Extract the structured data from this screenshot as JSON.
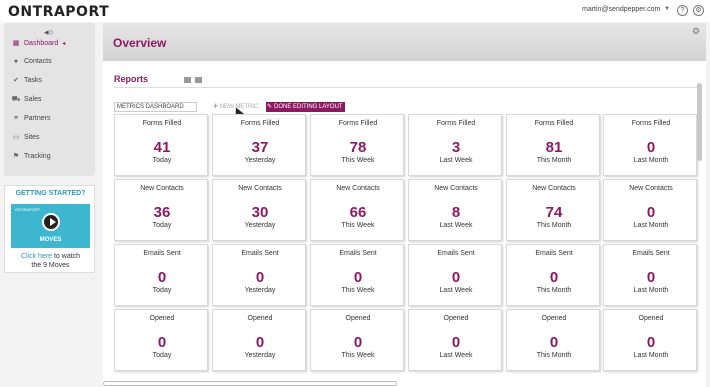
{
  "app": {
    "logo": "ONTRAPORT",
    "user_email": "martin@sendpepper.com",
    "user_caret": "▼",
    "help": "?",
    "gear": "⚙"
  },
  "sidebar": {
    "collapse": "◂○",
    "items": [
      {
        "label": "Dashboard",
        "icon": "▦"
      },
      {
        "label": "Contacts",
        "icon": "●"
      },
      {
        "label": "Tasks",
        "icon": "✔"
      },
      {
        "label": "Sales",
        "icon": "⛟"
      },
      {
        "label": "Partners",
        "icon": "⚭"
      },
      {
        "label": "Sites",
        "icon": "▭"
      },
      {
        "label": "Tracking",
        "icon": "⚑"
      }
    ],
    "active_caret": "◂"
  },
  "promo": {
    "title": "GETTING STARTED?",
    "image_brand": "ONTRAPORT",
    "image_caption": "MOVES",
    "link": "Click here",
    "text_after": " to watch",
    "text_line2": "the 9 Moves"
  },
  "main": {
    "title": "Overview",
    "gear": "⚙",
    "reports_title": "Reports",
    "dashboard_select": "METRICS DASHBOARD",
    "new_metric": "✚ NEW METRIC",
    "done_label": "DONE EDITING LAYOUT",
    "done_icon": "✎"
  },
  "metrics": [
    [
      {
        "label": "Forms Filled",
        "value": "41",
        "period": "Today"
      },
      {
        "label": "Forms Filled",
        "value": "37",
        "period": "Yesterday"
      },
      {
        "label": "Forms Filled",
        "value": "78",
        "period": "This Week"
      },
      {
        "label": "Forms Filled",
        "value": "3",
        "period": "Last Week"
      },
      {
        "label": "Forms Filled",
        "value": "81",
        "period": "This Month"
      },
      {
        "label": "Forms Filled",
        "value": "0",
        "period": "Last Month"
      }
    ],
    [
      {
        "label": "New Contacts",
        "value": "36",
        "period": "Today"
      },
      {
        "label": "New Contacts",
        "value": "30",
        "period": "Yesterday"
      },
      {
        "label": "New Contacts",
        "value": "66",
        "period": "This Week"
      },
      {
        "label": "New Contacts",
        "value": "8",
        "period": "Last Week"
      },
      {
        "label": "New Contacts",
        "value": "74",
        "period": "This Month"
      },
      {
        "label": "New Contacts",
        "value": "0",
        "period": "Last Month"
      }
    ],
    [
      {
        "label": "Emails Sent",
        "value": "0",
        "period": "Today"
      },
      {
        "label": "Emails Sent",
        "value": "0",
        "period": "Yesterday"
      },
      {
        "label": "Emails Sent",
        "value": "0",
        "period": "This Week"
      },
      {
        "label": "Emails Sent",
        "value": "0",
        "period": "Last Week"
      },
      {
        "label": "Emails Sent",
        "value": "0",
        "period": "This Month"
      },
      {
        "label": "Emails Sent",
        "value": "0",
        "period": "Last Month"
      }
    ],
    [
      {
        "label": "Opened",
        "value": "0",
        "period": "Today"
      },
      {
        "label": "Opened",
        "value": "0",
        "period": "Yesterday"
      },
      {
        "label": "Opened",
        "value": "0",
        "period": "This Week"
      },
      {
        "label": "Opened",
        "value": "0",
        "period": "Last Week"
      },
      {
        "label": "Opened",
        "value": "0",
        "period": "This Month"
      },
      {
        "label": "Opened",
        "value": "0",
        "period": "Last Month"
      }
    ]
  ]
}
